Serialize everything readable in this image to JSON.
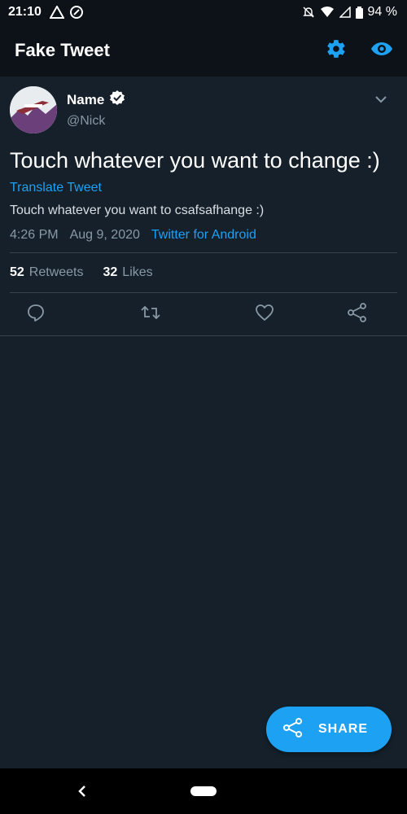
{
  "status_bar": {
    "time": "21:10",
    "battery": "94 %"
  },
  "app_bar": {
    "title": "Fake Tweet"
  },
  "tweet": {
    "name": "Name",
    "handle": "@Nick",
    "text": "Touch whatever you want to change :)",
    "translate_label": "Translate Tweet",
    "translated_text": "Touch whatever you want to csafsafhange :)",
    "time": "4:26 PM",
    "date": "Aug 9, 2020",
    "source": "Twitter for Android",
    "retweets_count": "52",
    "retweets_label": "Retweets",
    "likes_count": "32",
    "likes_label": "Likes"
  },
  "fab": {
    "label": "SHARE"
  },
  "colors": {
    "background": "#15202b",
    "bar": "#0d1218",
    "accent": "#1da1f2",
    "secondary_text": "#8899a6",
    "divider": "#38444d"
  }
}
